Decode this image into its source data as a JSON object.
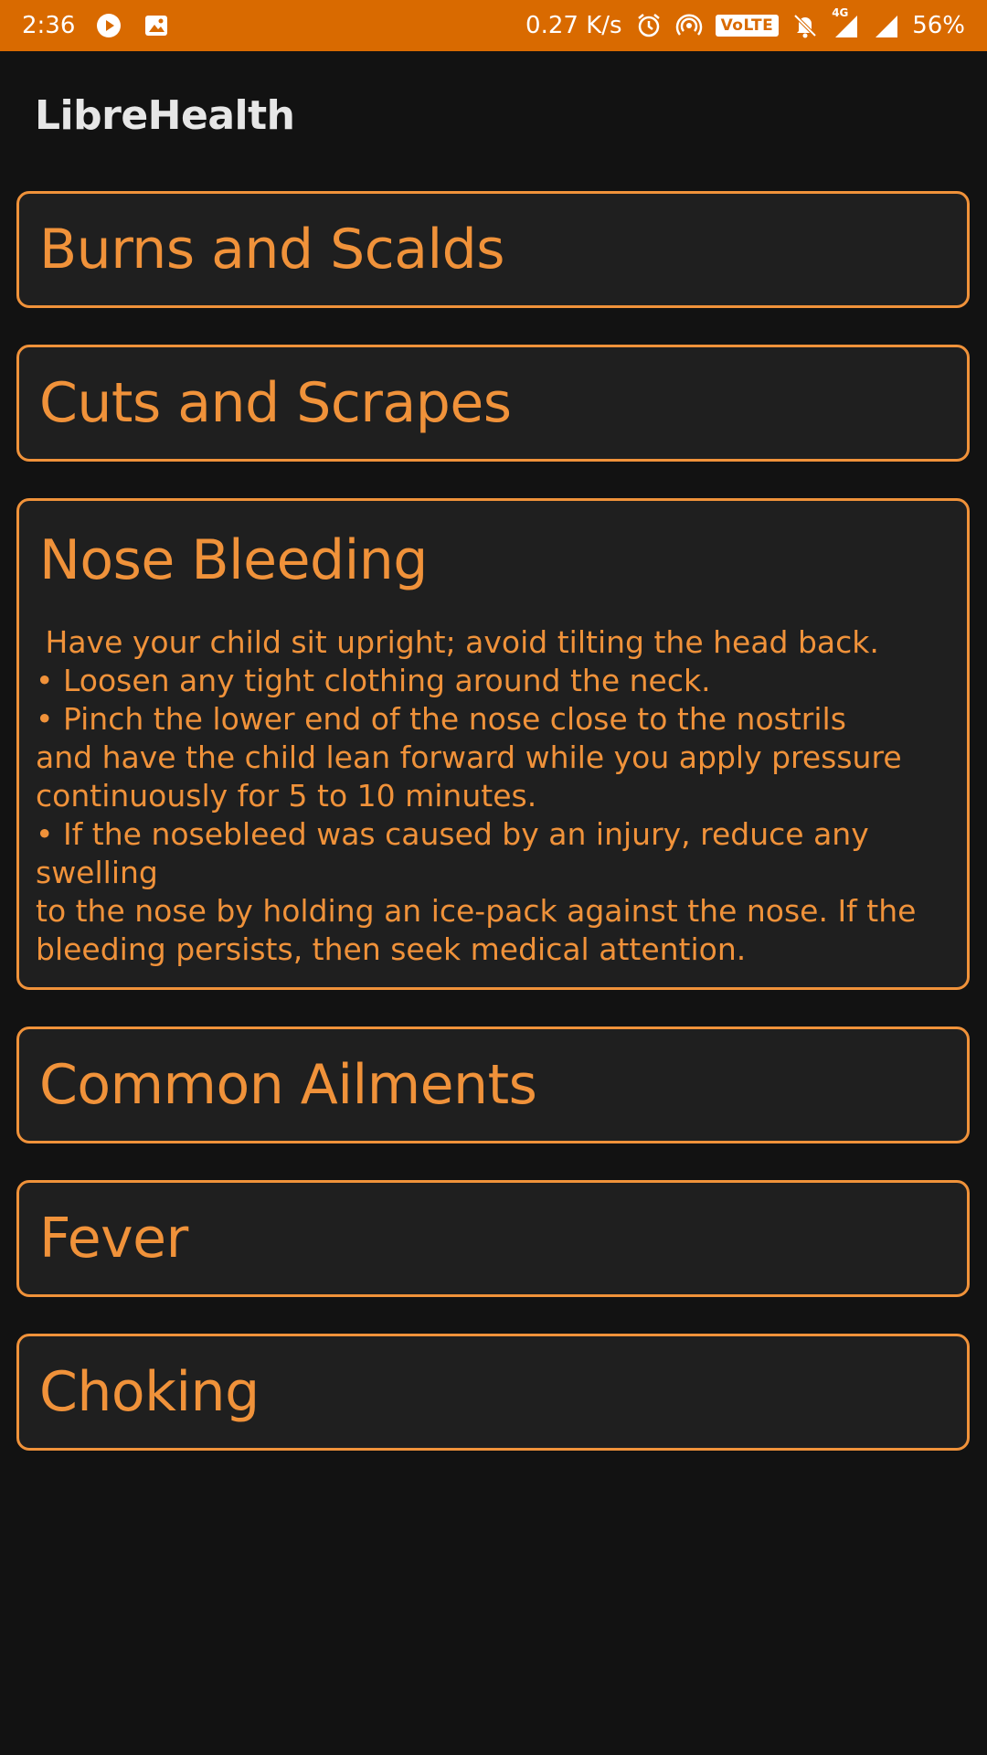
{
  "status_bar": {
    "time": "2:36",
    "speed": "0.27 K/s",
    "volte": "VoLTE",
    "network": "4G",
    "battery": "56%"
  },
  "app": {
    "title": "LibreHealth"
  },
  "cards": [
    {
      "title": "Burns and Scalds"
    },
    {
      "title": "Cuts and Scrapes"
    },
    {
      "title": "Nose Bleeding",
      "lines": [
        " Have your child sit upright; avoid tilting the head back.",
        "• Loosen any tight clothing around the neck.",
        "• Pinch the lower end of the nose close to the nostrils",
        "and have the child lean forward while you apply pressure",
        "continuously for 5 to 10 minutes.",
        "• If the nosebleed was caused by an injury, reduce any swelling",
        "to the nose by holding an ice-pack against the nose. If the",
        "bleeding persists, then seek medical attention."
      ]
    },
    {
      "title": "Common Ailments"
    },
    {
      "title": "Fever"
    },
    {
      "title": "Choking"
    }
  ],
  "colors": {
    "accent": "#f0923a",
    "status_bar": "#d96a00",
    "background": "#121212",
    "card": "#1f1f1f"
  }
}
